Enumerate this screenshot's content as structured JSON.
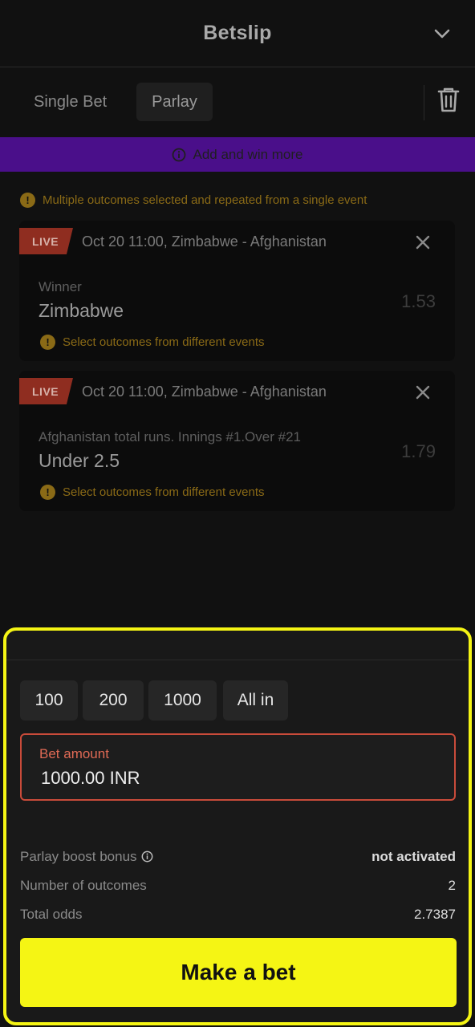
{
  "header": {
    "title": "Betslip"
  },
  "tabs": {
    "single": "Single Bet",
    "parlay": "Parlay"
  },
  "promo": {
    "text": "Add and win more"
  },
  "warning": {
    "text": "Multiple outcomes selected and repeated from a single event"
  },
  "bets": [
    {
      "live_label": "LIVE",
      "event": "Oct 20 11:00, Zimbabwe - Afghanistan",
      "market": "Winner",
      "outcome": "Zimbabwe",
      "odds": "1.53",
      "warning": "Select outcomes from different events"
    },
    {
      "live_label": "LIVE",
      "event": "Oct 20 11:00, Zimbabwe - Afghanistan",
      "market": "Afghanistan total runs. Innings #1.Over #21",
      "outcome": "Under 2.5",
      "odds": "1.79",
      "warning": "Select outcomes from different events"
    }
  ],
  "quick_amounts": [
    "100",
    "200",
    "1000",
    "All in"
  ],
  "amount": {
    "label": "Bet amount",
    "value": "1000.00 INR"
  },
  "summary": {
    "boost_label": "Parlay boost bonus",
    "boost_value": "not activated",
    "outcomes_label": "Number of outcomes",
    "outcomes_value": "2",
    "odds_label": "Total odds",
    "odds_value": "2.7387"
  },
  "cta": {
    "label": "Make a bet"
  },
  "colors": {
    "accent": "#f5f514",
    "promo": "#4a0f8a",
    "live": "#8f2d20",
    "warning": "#8a6a16",
    "error_border": "#c94b3a"
  },
  "icons": {
    "header": "chevron-down-icon",
    "delete": "trash-icon",
    "promo": "info-icon",
    "close": "close-icon",
    "warning": "warning-icon"
  }
}
